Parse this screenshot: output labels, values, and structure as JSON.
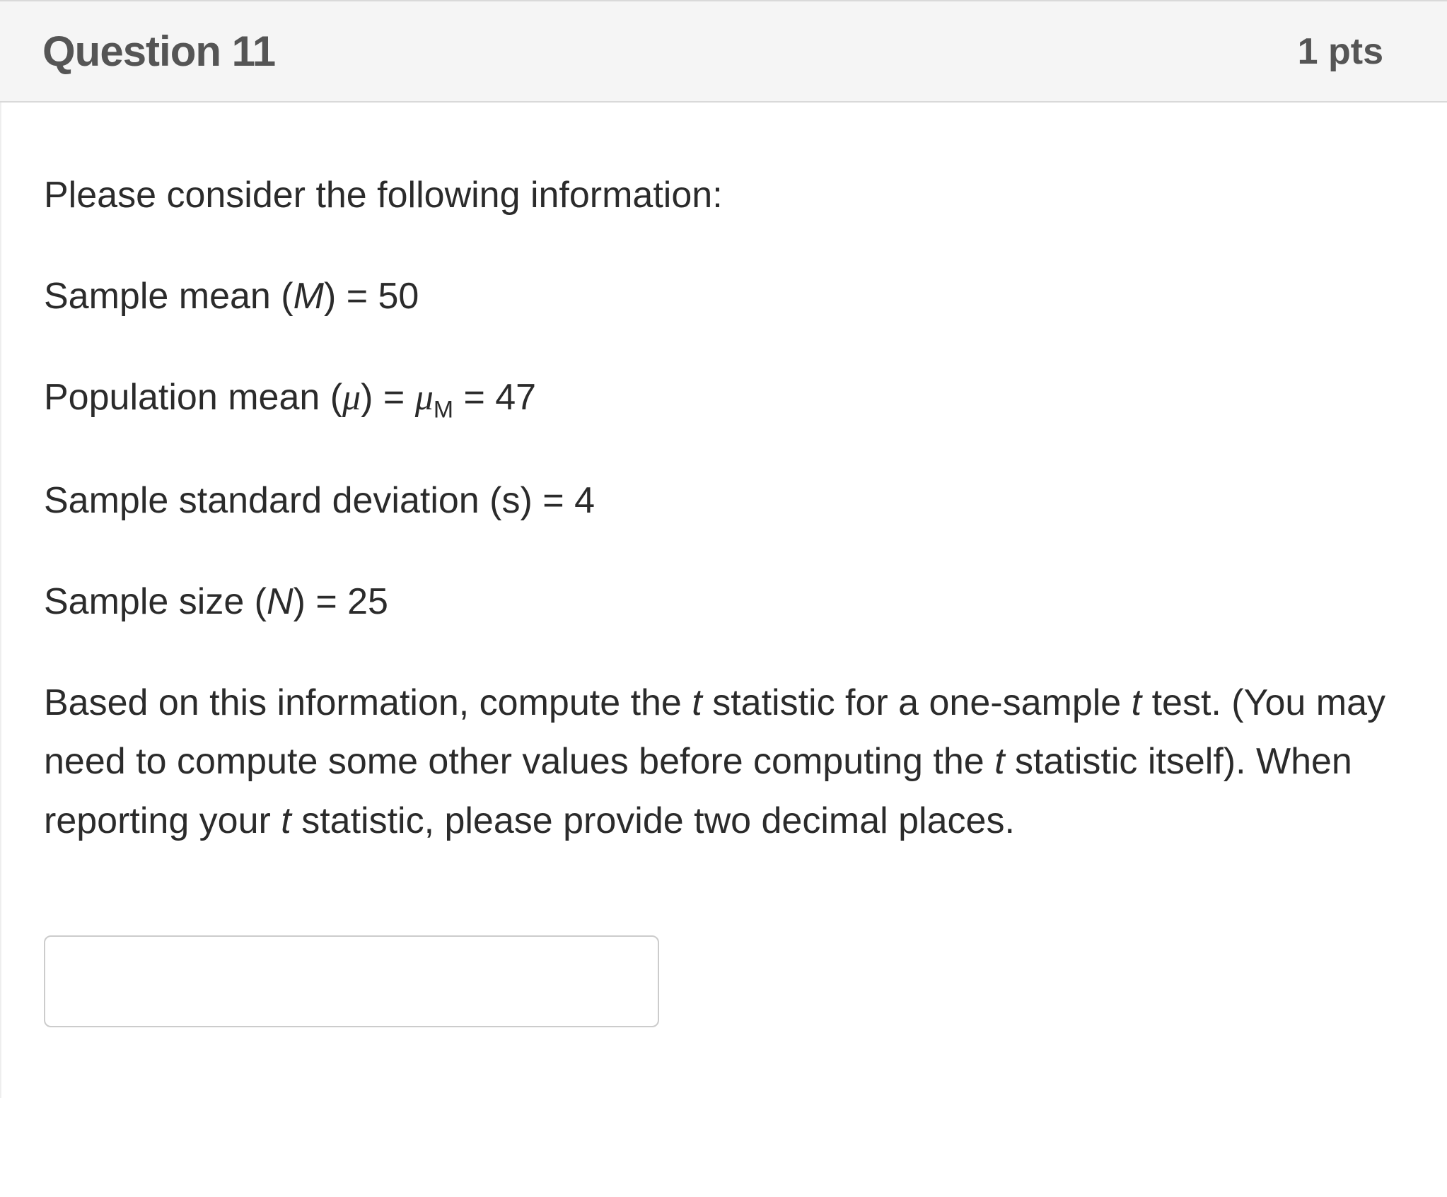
{
  "header": {
    "title": "Question 11",
    "points": "1 pts"
  },
  "body": {
    "intro": "Please consider the following information:",
    "sample_mean_label": "Sample mean (",
    "sample_mean_sym": "M",
    "sample_mean_after": ") = 50",
    "pop_mean_label": "Population mean (",
    "pop_mean_sym1": "μ",
    "pop_mean_mid": ") = ",
    "pop_mean_sym2": "μ",
    "pop_mean_sub": "M",
    "pop_mean_after": " = 47",
    "sd_label": "Sample standard deviation (s) = 4",
    "n_label": "Sample size (",
    "n_sym": "N",
    "n_after": ") = 25",
    "prompt_part1": "Based on this information, compute the ",
    "prompt_t1": "t",
    "prompt_part2": " statistic for a one-sample ",
    "prompt_t2": "t",
    "prompt_part3": " test. (You may need to compute some other values before computing the ",
    "prompt_t3": "t",
    "prompt_part4": " statistic itself).  When reporting your ",
    "prompt_t4": "t",
    "prompt_part5": " statistic, please provide two decimal places."
  },
  "input": {
    "value": ""
  }
}
